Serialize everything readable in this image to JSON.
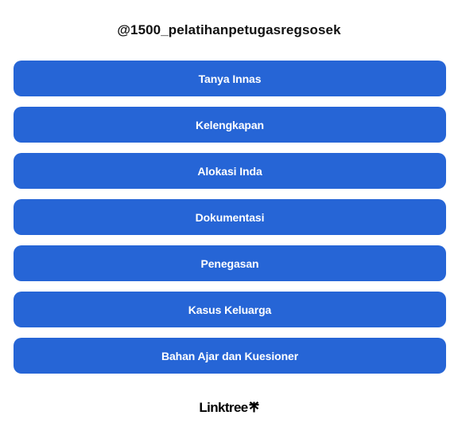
{
  "profile": {
    "handle": "@1500_pelatihanpetugasregsosek"
  },
  "links": [
    {
      "label": "Tanya Innas"
    },
    {
      "label": "Kelengkapan"
    },
    {
      "label": "Alokasi Inda"
    },
    {
      "label": "Dokumentasi"
    },
    {
      "label": "Penegasan"
    },
    {
      "label": "Kasus Keluarga"
    },
    {
      "label": "Bahan Ajar dan Kuesioner"
    }
  ],
  "footer": {
    "brand": "Linktree",
    "icon": "linktree-asterisk-icon"
  },
  "colors": {
    "button_background": "#2665d6",
    "button_text": "#ffffff",
    "page_background": "#ffffff"
  }
}
